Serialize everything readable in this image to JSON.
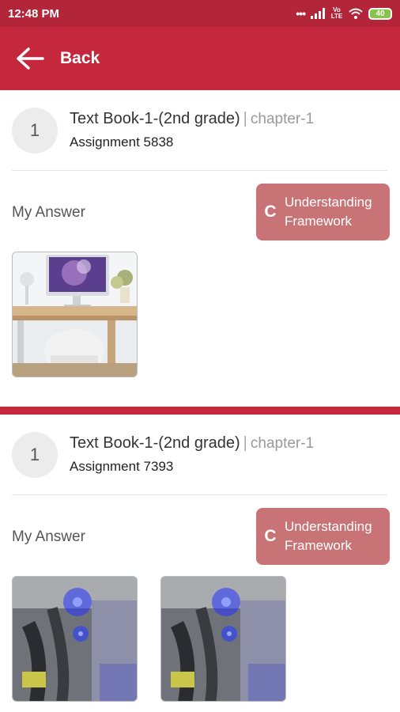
{
  "status_bar": {
    "time": "12:48 PM",
    "network": "Vo LTE",
    "battery": "40",
    "icons": [
      "dots-icon",
      "signal-icon",
      "volte-icon",
      "wifi-icon",
      "battery-icon"
    ]
  },
  "app_bar": {
    "back_label": "Back",
    "back_icon": "arrow-left-icon"
  },
  "colors": {
    "primary": "#c5283d",
    "status_bar": "#b3263a",
    "badge": "#c87476"
  },
  "assignments": [
    {
      "number": "1",
      "book_title": "Text Book-1-(2nd grade)",
      "separator": "|",
      "chapter": "chapter-1",
      "assignment": "Assignment 5838",
      "answer_label": "My Answer",
      "grade_letter": "C",
      "grade_text_line1": "Understanding",
      "grade_text_line2": "Framework",
      "images": [
        "desk-computer-photo"
      ]
    },
    {
      "number": "1",
      "book_title": "Text Book-1-(2nd grade)",
      "separator": "|",
      "chapter": "chapter-1",
      "assignment": "Assignment 7393",
      "answer_label": "My Answer",
      "grade_letter": "C",
      "grade_text_line1": "Understanding",
      "grade_text_line2": "Framework",
      "images": [
        "blue-led-cable-photo",
        "blue-led-cable-photo"
      ]
    }
  ]
}
